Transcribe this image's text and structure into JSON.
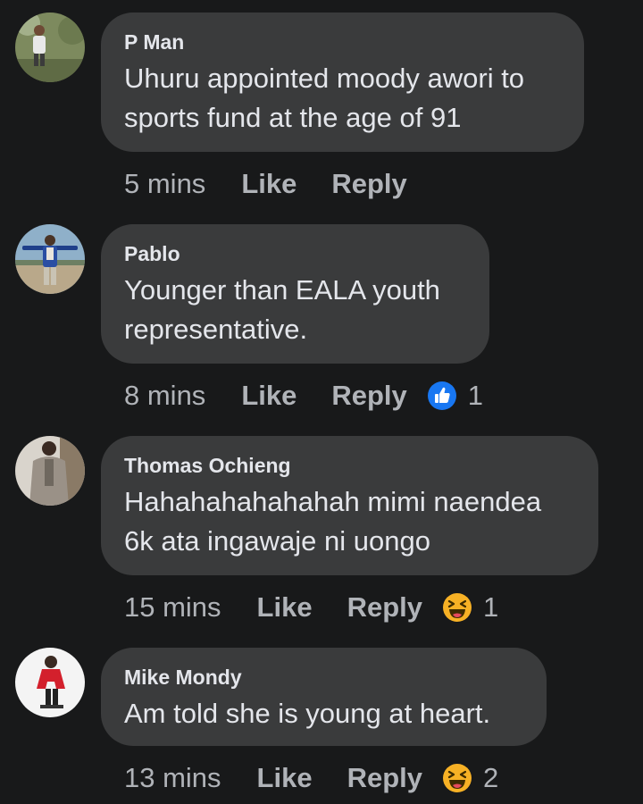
{
  "comments": [
    {
      "author": "P Man",
      "text": "Uhuru appointed moody awori to sports fund at the age of 91",
      "time": "5 mins",
      "like": "Like",
      "reply": "Reply"
    },
    {
      "author": "Pablo",
      "text": "Younger than EALA youth representative.",
      "time": "8 mins",
      "like": "Like",
      "reply": "Reply",
      "reaction": {
        "icon": "like-reaction-icon",
        "count": "1",
        "color": "#1877f2"
      }
    },
    {
      "author": "Thomas Ochieng",
      "text": "Hahahahahahahah mimi naendea 6k ata ingawaje ni uongo",
      "time": "15 mins",
      "like": "Like",
      "reply": "Reply",
      "reaction": {
        "icon": "haha-reaction-icon",
        "count": "1",
        "color": "#f7b125"
      }
    },
    {
      "author": "Mike Mondy",
      "text": "Am told she is young at heart.",
      "time": "13 mins",
      "like": "Like",
      "reply": "Reply",
      "reaction": {
        "icon": "haha-reaction-icon",
        "count": "2",
        "color": "#f7b125"
      }
    }
  ],
  "colors": {
    "background": "#18191a",
    "bubble": "#3a3b3c",
    "primary_text": "#e4e6eb",
    "secondary_text": "#b0b3b8"
  }
}
